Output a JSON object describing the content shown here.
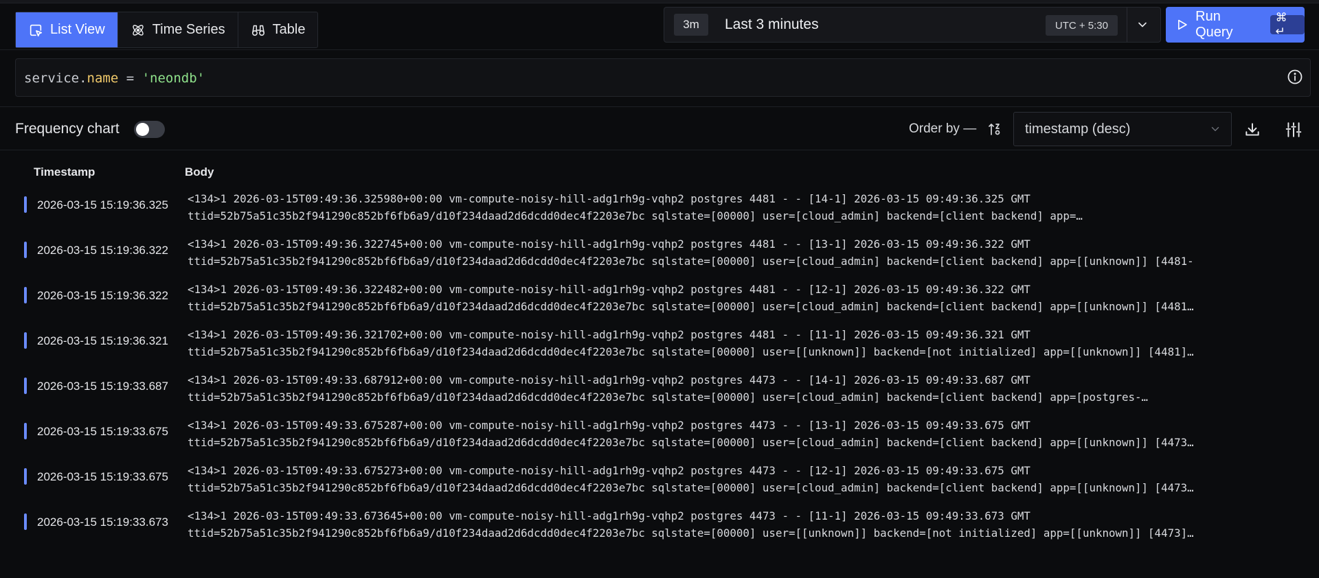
{
  "tabs": [
    {
      "label": "List View",
      "icon": "list-cursor-icon",
      "active": true
    },
    {
      "label": "Time Series",
      "icon": "atom-icon",
      "active": false
    },
    {
      "label": "Table",
      "icon": "binoculars-icon",
      "active": false
    }
  ],
  "time": {
    "chip": "3m",
    "label": "Last 3 minutes",
    "timezone": "UTC + 5:30"
  },
  "run": {
    "label": "Run Query",
    "shortcut": "⌘ ↵"
  },
  "query": {
    "key": "service.",
    "attr": "name",
    "op": " = ",
    "value": "'neondb'"
  },
  "frequency": {
    "label": "Frequency chart",
    "enabled": false
  },
  "order": {
    "label": "Order by —",
    "value": "timestamp (desc)"
  },
  "columns": {
    "timestamp": "Timestamp",
    "body": "Body"
  },
  "accent": "#4e74f8",
  "logs": [
    {
      "ts": "2026-03-15 15:19:36.325",
      "l1": "<134>1 2026-03-15T09:49:36.325980+00:00 vm-compute-noisy-hill-adg1rh9g-vqhp2 postgres 4481 - - [14-1] 2026-03-15 09:49:36.325 GMT",
      "l2": "ttid=52b75a51c35b2f941290c852bf6fb6a9/d10f234daad2d6dcdd0dec4f2203e7bc sqlstate=[00000] user=[cloud_admin] backend=[client backend] app=…"
    },
    {
      "ts": "2026-03-15 15:19:36.322",
      "l1": "<134>1 2026-03-15T09:49:36.322745+00:00 vm-compute-noisy-hill-adg1rh9g-vqhp2 postgres 4481 - - [13-1] 2026-03-15 09:49:36.322 GMT",
      "l2": "ttid=52b75a51c35b2f941290c852bf6fb6a9/d10f234daad2d6dcdd0dec4f2203e7bc sqlstate=[00000] user=[cloud_admin] backend=[client backend] app=[[unknown]] [4481-"
    },
    {
      "ts": "2026-03-15 15:19:36.322",
      "l1": "<134>1 2026-03-15T09:49:36.322482+00:00 vm-compute-noisy-hill-adg1rh9g-vqhp2 postgres 4481 - - [12-1] 2026-03-15 09:49:36.322 GMT",
      "l2": "ttid=52b75a51c35b2f941290c852bf6fb6a9/d10f234daad2d6dcdd0dec4f2203e7bc sqlstate=[00000] user=[cloud_admin] backend=[client backend] app=[[unknown]] [4481…"
    },
    {
      "ts": "2026-03-15 15:19:36.321",
      "l1": "<134>1 2026-03-15T09:49:36.321702+00:00 vm-compute-noisy-hill-adg1rh9g-vqhp2 postgres 4481 - - [11-1] 2026-03-15 09:49:36.321 GMT",
      "l2": "ttid=52b75a51c35b2f941290c852bf6fb6a9/d10f234daad2d6dcdd0dec4f2203e7bc sqlstate=[00000] user=[[unknown]] backend=[not initialized] app=[[unknown]] [4481]…"
    },
    {
      "ts": "2026-03-15 15:19:33.687",
      "l1": "<134>1 2026-03-15T09:49:33.687912+00:00 vm-compute-noisy-hill-adg1rh9g-vqhp2 postgres 4473 - - [14-1] 2026-03-15 09:49:33.687 GMT",
      "l2": "ttid=52b75a51c35b2f941290c852bf6fb6a9/d10f234daad2d6dcdd0dec4f2203e7bc sqlstate=[00000] user=[cloud_admin] backend=[client backend] app=[postgres-…"
    },
    {
      "ts": "2026-03-15 15:19:33.675",
      "l1": "<134>1 2026-03-15T09:49:33.675287+00:00 vm-compute-noisy-hill-adg1rh9g-vqhp2 postgres 4473 - - [13-1] 2026-03-15 09:49:33.675 GMT",
      "l2": "ttid=52b75a51c35b2f941290c852bf6fb6a9/d10f234daad2d6dcdd0dec4f2203e7bc sqlstate=[00000] user=[cloud_admin] backend=[client backend] app=[[unknown]] [4473…"
    },
    {
      "ts": "2026-03-15 15:19:33.675",
      "l1": "<134>1 2026-03-15T09:49:33.675273+00:00 vm-compute-noisy-hill-adg1rh9g-vqhp2 postgres 4473 - - [12-1] 2026-03-15 09:49:33.675 GMT",
      "l2": "ttid=52b75a51c35b2f941290c852bf6fb6a9/d10f234daad2d6dcdd0dec4f2203e7bc sqlstate=[00000] user=[cloud_admin] backend=[client backend] app=[[unknown]] [4473…"
    },
    {
      "ts": "2026-03-15 15:19:33.673",
      "l1": "<134>1 2026-03-15T09:49:33.673645+00:00 vm-compute-noisy-hill-adg1rh9g-vqhp2 postgres 4473 - - [11-1] 2026-03-15 09:49:33.673 GMT",
      "l2": "ttid=52b75a51c35b2f941290c852bf6fb6a9/d10f234daad2d6dcdd0dec4f2203e7bc sqlstate=[00000] user=[[unknown]] backend=[not initialized] app=[[unknown]] [4473]…"
    }
  ]
}
